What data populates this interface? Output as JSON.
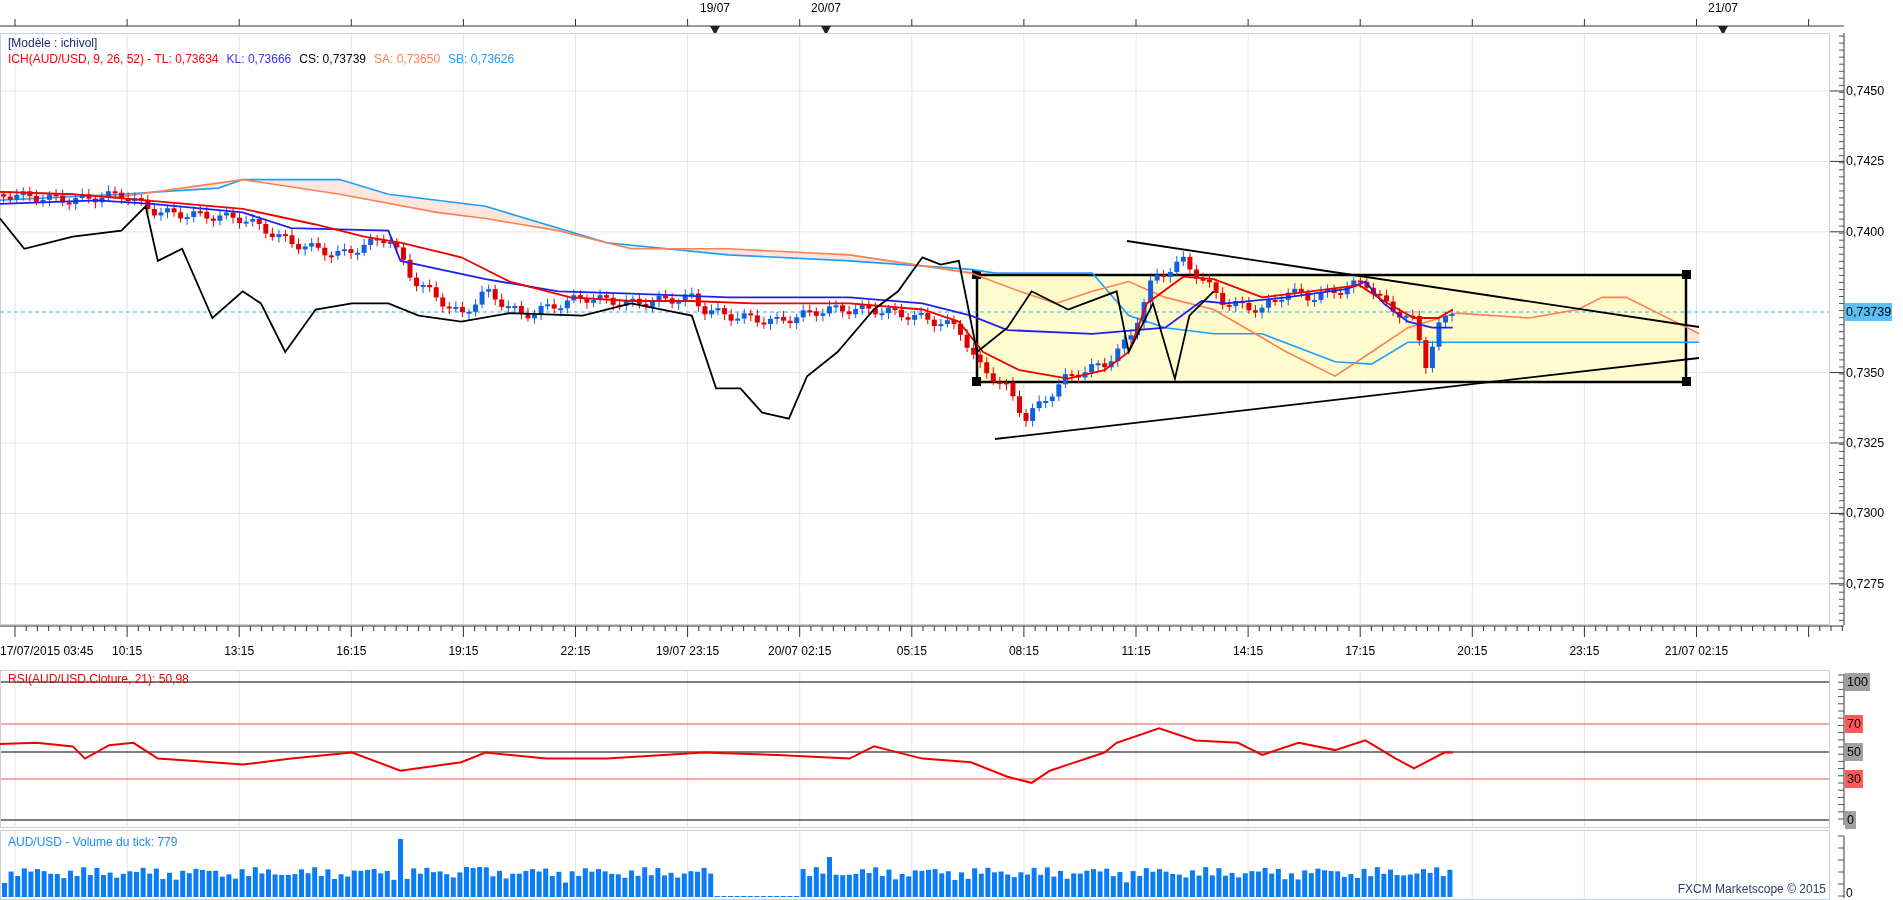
{
  "top_dates": [
    "19/07",
    "20/07",
    "21/07"
  ],
  "legend": {
    "title": "[Modèle : ichivol]",
    "items": [
      {
        "text": "ICH(AUD/USD, 9, 26, 52) -  TL: 0,73634",
        "color": "#ff0000"
      },
      {
        "text": "KL: 0,73666",
        "color": "#3333ff"
      },
      {
        "text": "CS: 0,73739",
        "color": "#000000"
      },
      {
        "text": "SA: 0,73650",
        "color": "#ff8050"
      },
      {
        "text": "SB: 0,73626",
        "color": "#1a9fff"
      }
    ]
  },
  "price_axis": {
    "labels": [
      "0,7450",
      "0,7425",
      "0,7400",
      "0,7350",
      "0,7325",
      "0,7300",
      "0,7275"
    ],
    "current_price": "0,73739"
  },
  "time_axis": {
    "labels": [
      "17/07/2015 03:45",
      "10:15",
      "13:15",
      "16:15",
      "19:15",
      "22:15",
      "19/07 23:15",
      "20/07 02:15",
      "05:15",
      "08:15",
      "11:15",
      "14:15",
      "17:15",
      "20:15",
      "23:15",
      "21/07 02:15"
    ]
  },
  "rsi": {
    "title": "RSI(AUD/USD.Cloture, 21): 50,98",
    "levels": [
      {
        "label": "100",
        "kind": "bound"
      },
      {
        "label": "70",
        "kind": "threshold"
      },
      {
        "label": "50",
        "kind": "bound"
      },
      {
        "label": "30",
        "kind": "threshold"
      },
      {
        "label": "0",
        "kind": "bound"
      }
    ]
  },
  "volume": {
    "title": "AUD/USD - Volume du tick: 779",
    "axis_label": "0"
  },
  "footer": "FXCM Marketscope © 2015"
}
